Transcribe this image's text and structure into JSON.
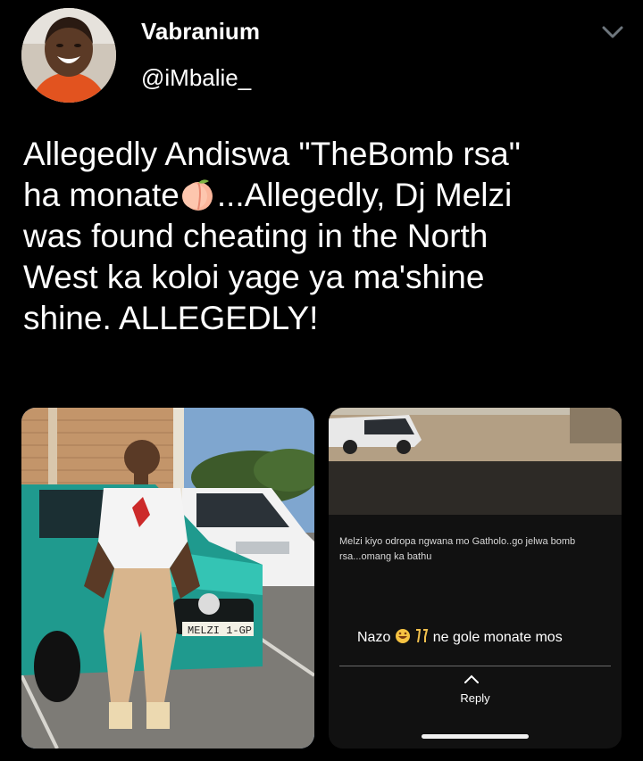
{
  "author": {
    "display_name": "Vabranium",
    "handle": "@iMbalie_"
  },
  "tweet": {
    "lines": [
      "Allegedly Andiswa \"TheBomb rsa\"",
      "ha monate",
      "...Allegedly, Dj Melzi",
      "was found cheating in the North",
      "West ka koloi yage ya ma'shine",
      "shine. ALLEGEDLY!"
    ],
    "emoji": "peach"
  },
  "media": {
    "photo": {
      "plate_text": "MELZI 1-GP"
    },
    "screenshot": {
      "caption": "Melzi kiyo odropa ngwana mo Gatholo..go jelwa bomb rsa...omang ka bathu",
      "reply_prefix": "Nazo",
      "reply_suffix": "ne gole monate mos",
      "reply_button": "Reply"
    }
  },
  "colors": {
    "background": "#000000",
    "text": "#ffffff",
    "muted": "#8b98a5",
    "car_teal": "#1f9a8e"
  },
  "icons": [
    "chevron-down-icon",
    "peach-emoji",
    "laughing-emoji",
    "clinking-glasses-emoji",
    "chevron-up-icon"
  ]
}
